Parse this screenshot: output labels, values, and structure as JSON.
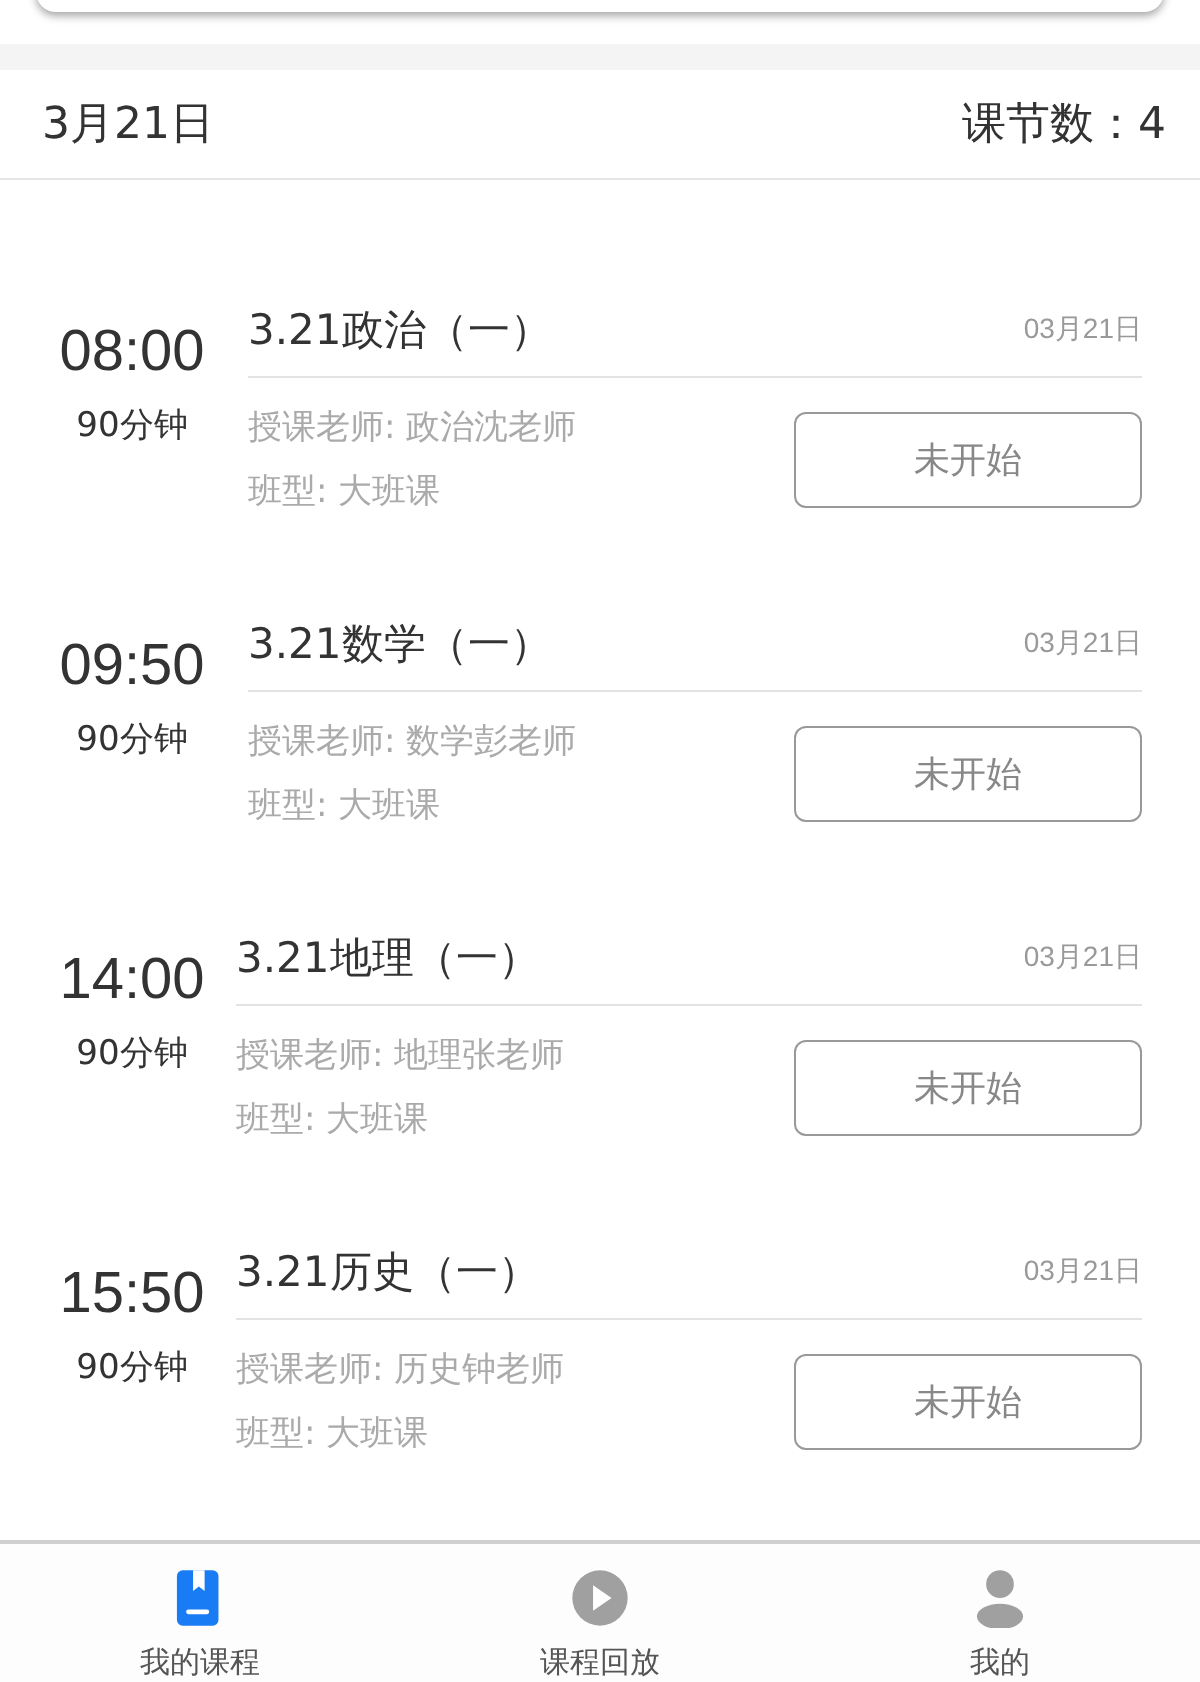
{
  "header": {
    "date": "3月21日",
    "lesson_count": "课节数：4"
  },
  "lessons": [
    {
      "time": "08:00",
      "duration": "90分钟",
      "title": "3.21政治（一）",
      "date": "03月21日",
      "teacher": "授课老师: 政治沈老师",
      "class_type": "班型: 大班课",
      "status": "未开始"
    },
    {
      "time": "09:50",
      "duration": "90分钟",
      "title": "3.21数学（一）",
      "date": "03月21日",
      "teacher": "授课老师: 数学彭老师",
      "class_type": "班型: 大班课",
      "status": "未开始"
    },
    {
      "time": "14:00",
      "duration": "90分钟",
      "title": "3.21地理（一）",
      "date": "03月21日",
      "teacher": "授课老师: 地理张老师",
      "class_type": "班型: 大班课",
      "status": "未开始"
    },
    {
      "time": "15:50",
      "duration": "90分钟",
      "title": "3.21历史（一）",
      "date": "03月21日",
      "teacher": "授课老师: 历史钟老师",
      "class_type": "班型: 大班课",
      "status": "未开始"
    }
  ],
  "tab_bar": [
    {
      "label": "我的课程",
      "kind": "book",
      "selected": true
    },
    {
      "label": "课程回放",
      "kind": "play",
      "selected": false
    },
    {
      "label": "我的",
      "kind": "person",
      "selected": false
    }
  ]
}
